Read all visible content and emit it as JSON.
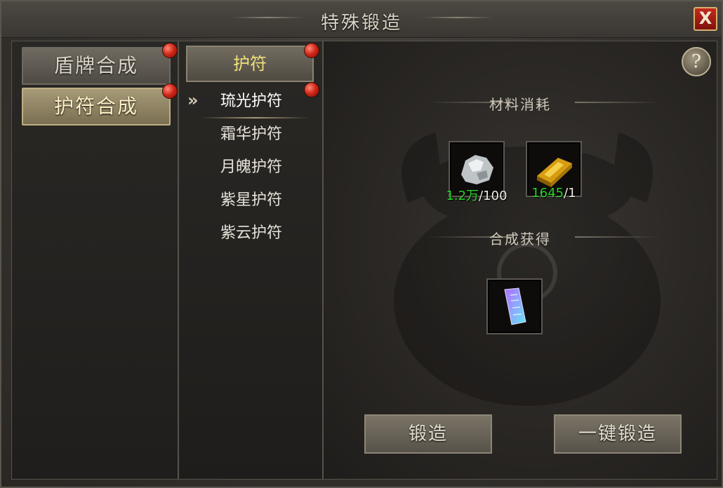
{
  "window": {
    "title": "特殊锻造",
    "close_label": "X"
  },
  "categories": [
    {
      "label": "盾牌合成",
      "active": false,
      "badge": true
    },
    {
      "label": "护符合成",
      "active": true,
      "badge": true
    }
  ],
  "subpanel": {
    "header": "护符",
    "items": [
      {
        "label": "琉光护符",
        "selected": true,
        "badge": true
      },
      {
        "label": "霜华护符",
        "selected": false
      },
      {
        "label": "月魄护符",
        "selected": false
      },
      {
        "label": "紫星护符",
        "selected": false
      },
      {
        "label": "紫云护符",
        "selected": false
      }
    ]
  },
  "detail": {
    "help_label": "?",
    "materials_label": "材料消耗",
    "result_label": "合成获得",
    "materials": [
      {
        "icon": "silver-ore-icon",
        "have": "1.2万",
        "need": "/100"
      },
      {
        "icon": "gold-bar-icon",
        "have": "1645",
        "need": "/1"
      }
    ],
    "result": {
      "icon": "crystal-talisman-icon"
    },
    "forge_label": "锻造",
    "forge_all_label": "一键锻造"
  },
  "colors": {
    "have_green": "#27d429",
    "header_yellow": "#f0e17a",
    "badge_red": "#d42a1a"
  }
}
